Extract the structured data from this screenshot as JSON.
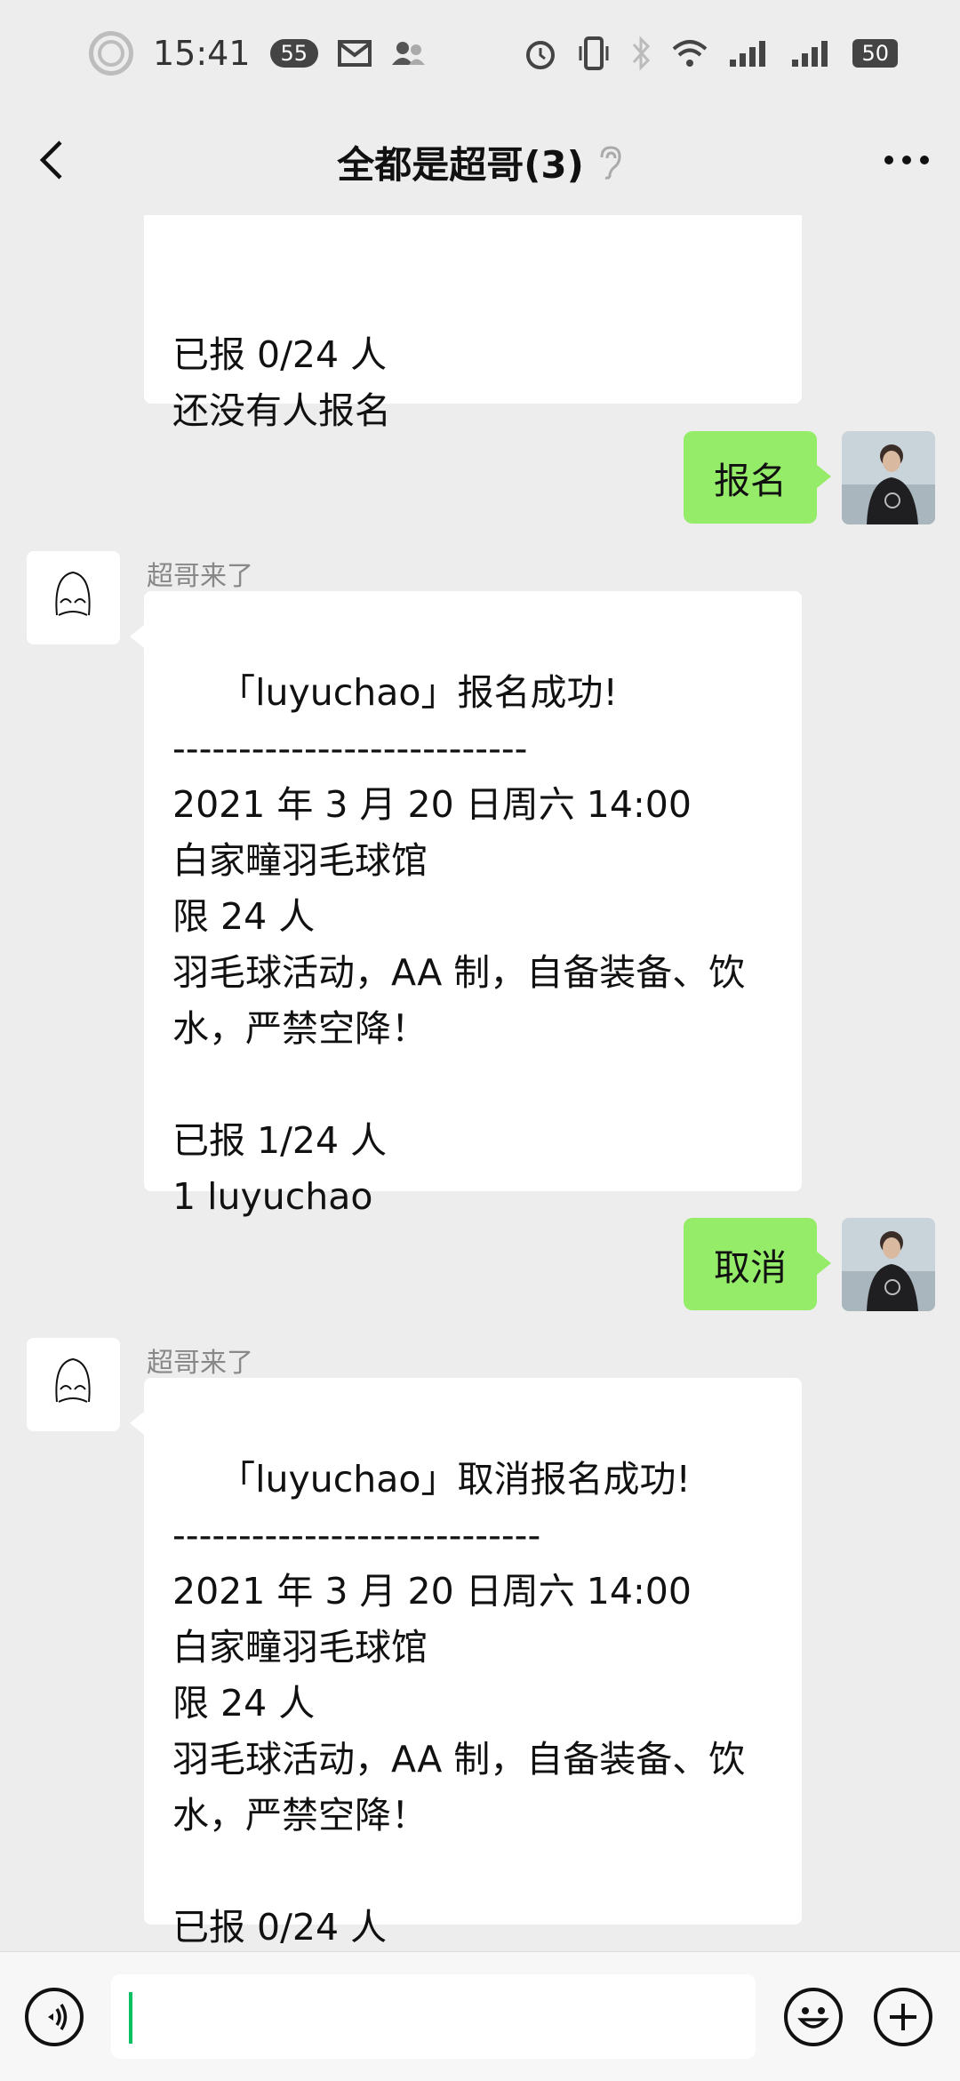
{
  "status": {
    "time": "15:41",
    "notif_count": "55",
    "battery": "50"
  },
  "header": {
    "title": "全都是超哥(3)"
  },
  "messages": {
    "top_partial": "\n已报 0/24 人\n还没有人报名",
    "me_1": "报名",
    "bot_name_1": "超哥来了",
    "bot_msg_1": "「luyuchao」报名成功!\n---------------------------\n2021 年 3 月 20 日周六 14:00\n白家疃羽毛球馆\n限 24 人\n羽毛球活动，AA 制，自备装备、饮水，严禁空降！\n\n已报 1/24 人\n1 luyuchao",
    "me_2": "取消",
    "bot_name_2": "超哥来了",
    "bot_msg_2": "「luyuchao」取消报名成功!\n----------------------------\n2021 年 3 月 20 日周六 14:00\n白家疃羽毛球馆\n限 24 人\n羽毛球活动，AA 制，自备装备、饮水，严禁空降！\n\n已报 0/24 人"
  },
  "icons": {
    "back": "chevron-left-icon",
    "more": "more-dots-icon",
    "ear": "ear-icon",
    "voice": "voice-icon",
    "emoji": "emoji-icon",
    "plus": "plus-icon"
  },
  "colors": {
    "green_bubble": "#95ec69",
    "background": "#ededed",
    "caret": "#07c160"
  }
}
